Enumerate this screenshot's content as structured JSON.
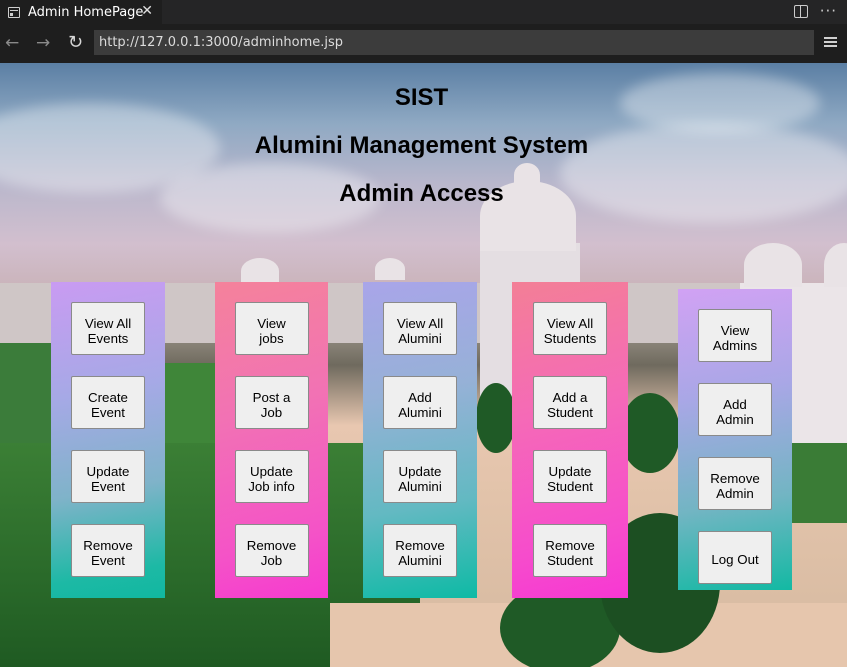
{
  "browser": {
    "tab_title": "Admin HomePage",
    "tab_close": "✕",
    "url": "http://127.0.0.1:3000/adminhome.jsp",
    "nav_back": "←",
    "nav_forward": "→",
    "nav_reload": "↻",
    "more_actions": "···"
  },
  "page": {
    "heading_1": "SIST",
    "heading_2": "Alumini Management System",
    "heading_3": "Admin Access"
  },
  "panels": [
    {
      "buttons": [
        "View All\nEvents",
        "Create\nEvent",
        "Update\nEvent",
        "Remove\nEvent"
      ]
    },
    {
      "buttons": [
        "View\njobs",
        "Post a\nJob",
        "Update\nJob info",
        "Remove\nJob"
      ]
    },
    {
      "buttons": [
        "View All\nAlumini",
        "Add\nAlumini",
        "Update\nAlumini",
        "Remove\nAlumini"
      ]
    },
    {
      "buttons": [
        "View All\nStudents",
        "Add a\nStudent",
        "Update\nStudent",
        "Remove\nStudent"
      ]
    },
    {
      "buttons": [
        "View\nAdmins",
        "Add\nAdmin",
        "Remove\nAdmin",
        "Log Out"
      ]
    }
  ],
  "colors": {
    "panel_violet_teal": "#c99bf2",
    "panel_pink": "#f453c7",
    "button_bg": "#efefef"
  }
}
